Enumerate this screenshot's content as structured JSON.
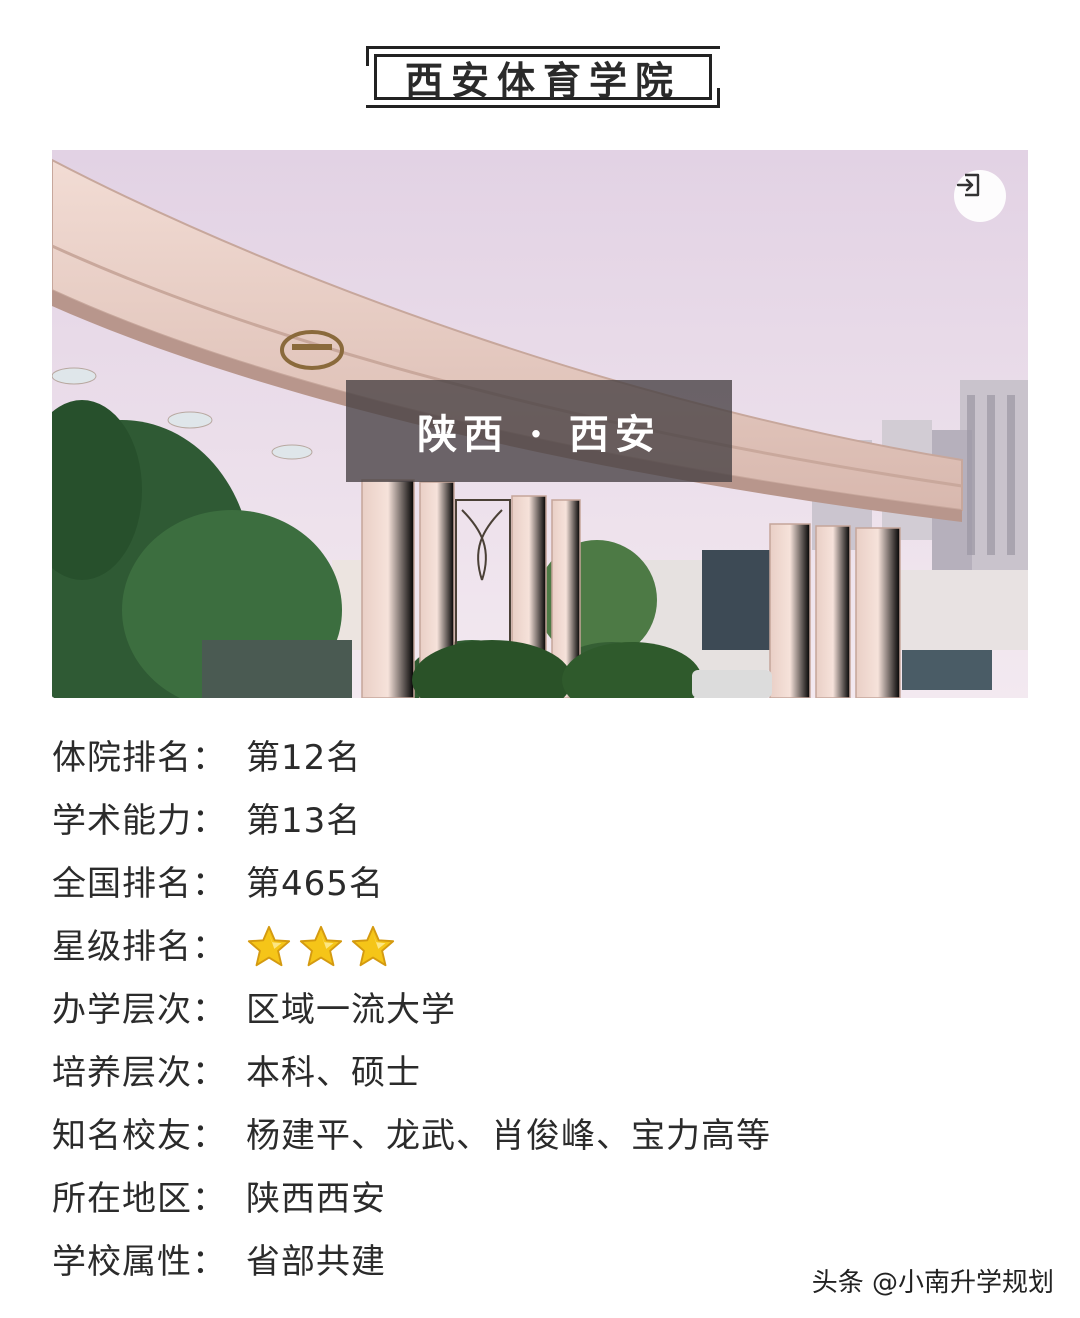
{
  "title": "西安体育学院",
  "photo": {
    "caption": "陕西 · 西安",
    "corner_button_icon": "exit-icon"
  },
  "info": {
    "rows": [
      {
        "label": "体院排名：",
        "value": "第12名"
      },
      {
        "label": "学术能力：",
        "value": "第13名"
      },
      {
        "label": "全国排名：",
        "value": "第465名"
      },
      {
        "label": "星级排名：",
        "stars": 3
      },
      {
        "label": "办学层次：",
        "value": "区域一流大学"
      },
      {
        "label": "培养层次：",
        "value": "本科、硕士"
      },
      {
        "label": "知名校友：",
        "value": "杨建平、龙武、肖俊峰、宝力高等"
      },
      {
        "label": "所在地区：",
        "value": "陕西西安"
      },
      {
        "label": "学校属性：",
        "value": "省部共建"
      }
    ]
  },
  "watermark": "头条 @小南升学规划",
  "colors": {
    "text": "#2b2b2b",
    "caption_bg": "#464042",
    "star": "#f5c518"
  }
}
